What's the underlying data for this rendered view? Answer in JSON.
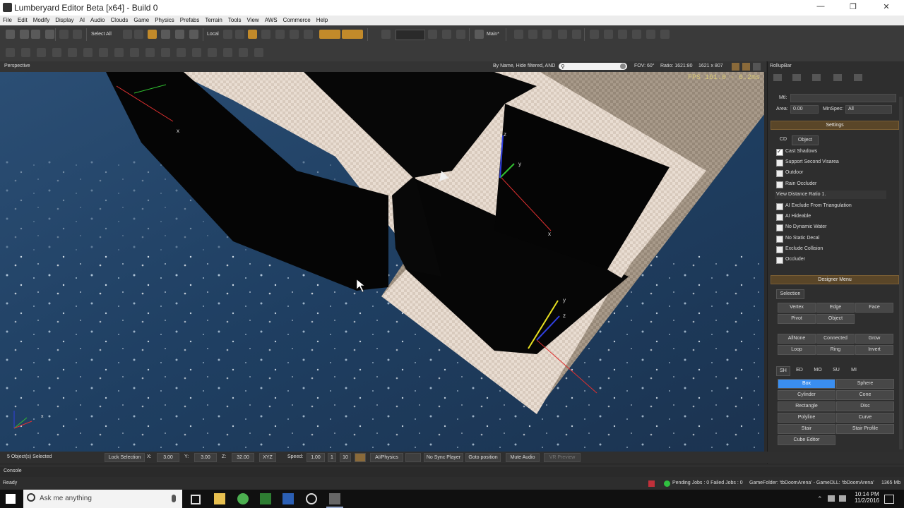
{
  "window": {
    "title": "Lumberyard Editor Beta [x64] - Build 0",
    "minimize": "—",
    "maximize": "❐",
    "close": "✕"
  },
  "menu": [
    "File",
    "Edit",
    "Modify",
    "Display",
    "AI",
    "Audio",
    "Clouds",
    "Game",
    "Physics",
    "Prefabs",
    "Terrain",
    "Tools",
    "View",
    "AWS",
    "Commerce",
    "Help"
  ],
  "toolbar": {
    "select_all": "Select All",
    "coord_system": "Local",
    "level_label": "Main*"
  },
  "viewport": {
    "name": "Perspective",
    "filter_label": "By Name, Hide filtered, AND",
    "fov": "FOV: 60°",
    "ratio": "Ratio: 1621:80",
    "resolution": "1621 x 807",
    "fps": "FPS 161.0 - 6.2ms",
    "gizmo_labels": [
      "x",
      "z",
      "y",
      "x",
      "y",
      "z",
      "x"
    ]
  },
  "rollup": {
    "title": "RollupBar",
    "mtl_label": "Mtl:",
    "area_label": "Area:",
    "area_value": "0.00",
    "minspec_label": "MinSpec:",
    "minspec_value": "All",
    "settings_header": "Settings",
    "settings_tabs": [
      "CD",
      "Object"
    ],
    "checkboxes": [
      {
        "label": "Cast Shadows",
        "checked": true
      },
      {
        "label": "Support Second Visarea",
        "checked": false
      },
      {
        "label": "Outdoor",
        "checked": false
      },
      {
        "label": "Rain Occluder",
        "checked": false
      }
    ],
    "view_distance_ratio": "View Distance Ratio  1.",
    "checkboxes2": [
      {
        "label": "AI Exclude From Triangulation",
        "checked": false
      },
      {
        "label": "AI Hideable",
        "checked": false
      },
      {
        "label": "No Dynamic Water",
        "checked": false
      },
      {
        "label": "No Static Decal",
        "checked": false
      },
      {
        "label": "Exclude Collision",
        "checked": false
      },
      {
        "label": "Occluder",
        "checked": false
      }
    ],
    "designer_header": "Designer Menu",
    "designer_tab": "Selection",
    "sel_buttons": [
      "Vertex",
      "Edge",
      "Face",
      "Pivot",
      "Object"
    ],
    "sel_buttons2": [
      "AllNone",
      "Connected",
      "Grow",
      "Loop",
      "Ring",
      "Invert"
    ],
    "shape_tabs": [
      "SH",
      "ED",
      "MO",
      "SU",
      "MI"
    ],
    "shapes": [
      [
        "Box",
        "Sphere"
      ],
      [
        "Cylinder",
        "Cone"
      ],
      [
        "Rectangle",
        "Disc"
      ],
      [
        "Polyline",
        "Curve"
      ],
      [
        "Stair",
        "Stair Profile"
      ],
      [
        "Cube Editor",
        ""
      ]
    ]
  },
  "status": {
    "selected": "5 Object(s) Selected",
    "lock": "Lock Selection",
    "x_label": "X:",
    "x": "3.00",
    "y_label": "Y:",
    "y": "3.00",
    "z_label": "Z:",
    "z": "32.00",
    "xyz": "XYZ",
    "speed_label": "Speed:",
    "speed": "1.00",
    "speed_presets": [
      "1",
      "10"
    ],
    "ai_physics": "AI/Physics",
    "sync": "No Sync Player",
    "goto": "Goto position",
    "mute": "Mute Audio",
    "vr": "VR Preview"
  },
  "console": "Console",
  "readybar": {
    "ready": "Ready",
    "jobs": "Pending Jobs : 0  Failed Jobs : 0",
    "folder": "GameFolder: 'tbDoomArena' - GameDLL: 'tbDoomArena'",
    "mem": "1365 Mb"
  },
  "taskbar": {
    "search": "Ask me anything",
    "time": "10:14 PM",
    "date": "11/2/2016"
  },
  "colors": {
    "accent": "#c28a2a",
    "selected": "#3a8ef0",
    "section": "#5a4628"
  }
}
